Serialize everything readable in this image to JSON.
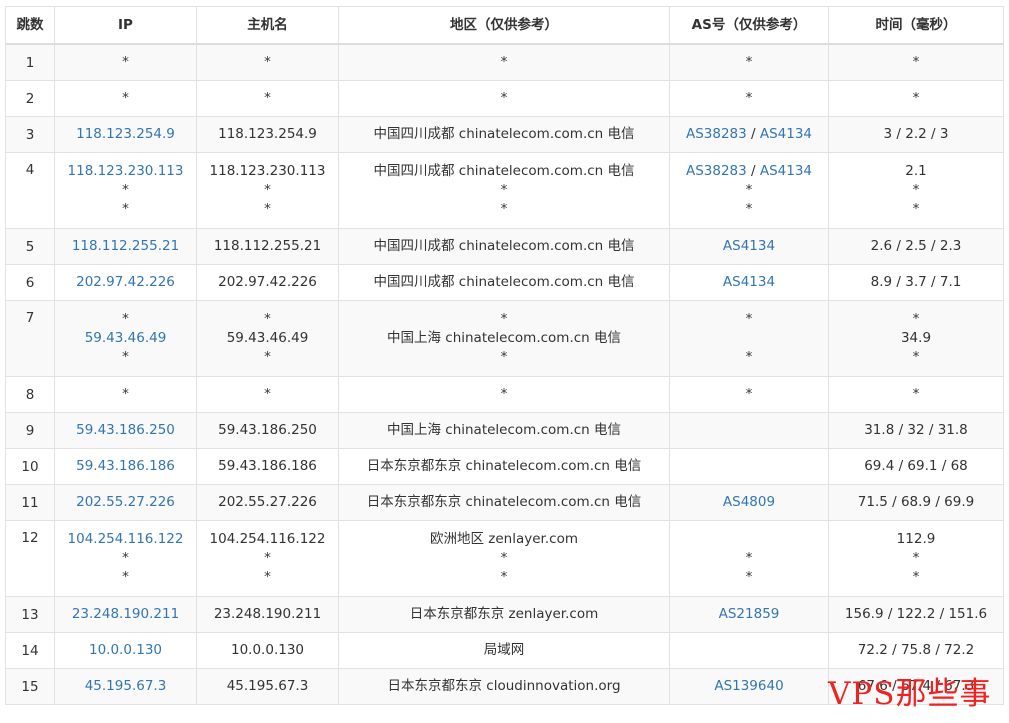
{
  "headers": {
    "hop": "跳数",
    "ip": "IP",
    "host": "主机名",
    "region": "地区（仅供参考）",
    "as": "AS号（仅供参考）",
    "time": "时间（毫秒）"
  },
  "rows": [
    {
      "hop": "1",
      "ip": [
        "*"
      ],
      "host": [
        "*"
      ],
      "region": [
        "*"
      ],
      "as": [
        "*"
      ],
      "time": [
        "*"
      ]
    },
    {
      "hop": "2",
      "ip": [
        "*"
      ],
      "host": [
        "*"
      ],
      "region": [
        "*"
      ],
      "as": [
        "*"
      ],
      "time": [
        "*"
      ]
    },
    {
      "hop": "3",
      "ip": [
        "118.123.254.9"
      ],
      "host": [
        "118.123.254.9"
      ],
      "region": [
        "中国四川成都 chinatelecom.com.cn 电信"
      ],
      "as": [
        [
          "AS38283",
          "AS4134"
        ]
      ],
      "time": [
        "3 / 2.2 / 3"
      ]
    },
    {
      "hop": "4",
      "ip": [
        "118.123.230.113",
        "*",
        "*"
      ],
      "host": [
        "118.123.230.113",
        "*",
        "*"
      ],
      "region": [
        "中国四川成都 chinatelecom.com.cn 电信",
        "*",
        "*"
      ],
      "as": [
        [
          "AS38283",
          "AS4134"
        ],
        "*",
        "*"
      ],
      "time": [
        "2.1",
        "*",
        "*"
      ]
    },
    {
      "hop": "5",
      "ip": [
        "118.112.255.21"
      ],
      "host": [
        "118.112.255.21"
      ],
      "region": [
        "中国四川成都 chinatelecom.com.cn 电信"
      ],
      "as": [
        [
          "AS4134"
        ]
      ],
      "time": [
        "2.6 / 2.5 / 2.3"
      ]
    },
    {
      "hop": "6",
      "ip": [
        "202.97.42.226"
      ],
      "host": [
        "202.97.42.226"
      ],
      "region": [
        "中国四川成都 chinatelecom.com.cn 电信"
      ],
      "as": [
        [
          "AS4134"
        ]
      ],
      "time": [
        "8.9 / 3.7 / 7.1"
      ]
    },
    {
      "hop": "7",
      "ip": [
        "*",
        "59.43.46.49",
        "*"
      ],
      "host": [
        "*",
        "59.43.46.49",
        "*"
      ],
      "region": [
        "*",
        "中国上海 chinatelecom.com.cn 电信",
        "*"
      ],
      "as": [
        "*",
        "",
        "*"
      ],
      "time": [
        "*",
        "34.9",
        "*"
      ]
    },
    {
      "hop": "8",
      "ip": [
        "*"
      ],
      "host": [
        "*"
      ],
      "region": [
        "*"
      ],
      "as": [
        "*"
      ],
      "time": [
        "*"
      ]
    },
    {
      "hop": "9",
      "ip": [
        "59.43.186.250"
      ],
      "host": [
        "59.43.186.250"
      ],
      "region": [
        "中国上海 chinatelecom.com.cn 电信"
      ],
      "as": [
        ""
      ],
      "time": [
        "31.8 / 32 / 31.8"
      ]
    },
    {
      "hop": "10",
      "ip": [
        "59.43.186.186"
      ],
      "host": [
        "59.43.186.186"
      ],
      "region": [
        "日本东京都东京 chinatelecom.com.cn 电信"
      ],
      "as": [
        ""
      ],
      "time": [
        "69.4 / 69.1 / 68"
      ]
    },
    {
      "hop": "11",
      "ip": [
        "202.55.27.226"
      ],
      "host": [
        "202.55.27.226"
      ],
      "region": [
        "日本东京都东京 chinatelecom.com.cn 电信"
      ],
      "as": [
        [
          "AS4809"
        ]
      ],
      "time": [
        "71.5 / 68.9 / 69.9"
      ]
    },
    {
      "hop": "12",
      "ip": [
        "104.254.116.122",
        "*",
        "*"
      ],
      "host": [
        "104.254.116.122",
        "*",
        "*"
      ],
      "region": [
        "欧洲地区 zenlayer.com",
        "*",
        "*"
      ],
      "as": [
        "",
        "*",
        "*"
      ],
      "time": [
        "112.9",
        "*",
        "*"
      ]
    },
    {
      "hop": "13",
      "ip": [
        "23.248.190.211"
      ],
      "host": [
        "23.248.190.211"
      ],
      "region": [
        "日本东京都东京 zenlayer.com"
      ],
      "as": [
        [
          "AS21859"
        ]
      ],
      "time": [
        "156.9 / 122.2 / 151.6"
      ]
    },
    {
      "hop": "14",
      "ip": [
        "10.0.0.130"
      ],
      "host": [
        "10.0.0.130"
      ],
      "region": [
        "局域网"
      ],
      "as": [
        ""
      ],
      "time": [
        "72.2 / 75.8 / 72.2"
      ]
    },
    {
      "hop": "15",
      "ip": [
        "45.195.67.3"
      ],
      "host": [
        "45.195.67.3"
      ],
      "region": [
        "日本东京都东京 cloudinnovation.org"
      ],
      "as": [
        [
          "AS139640"
        ]
      ],
      "time": [
        "67.6 / 67.4 / 67.3"
      ]
    }
  ],
  "watermark": "VPS那些事",
  "colors": {
    "link": "#3276b1",
    "border": "#e2e2e2",
    "stripe": "#f9f9f9",
    "watermark": "#ee2222"
  }
}
